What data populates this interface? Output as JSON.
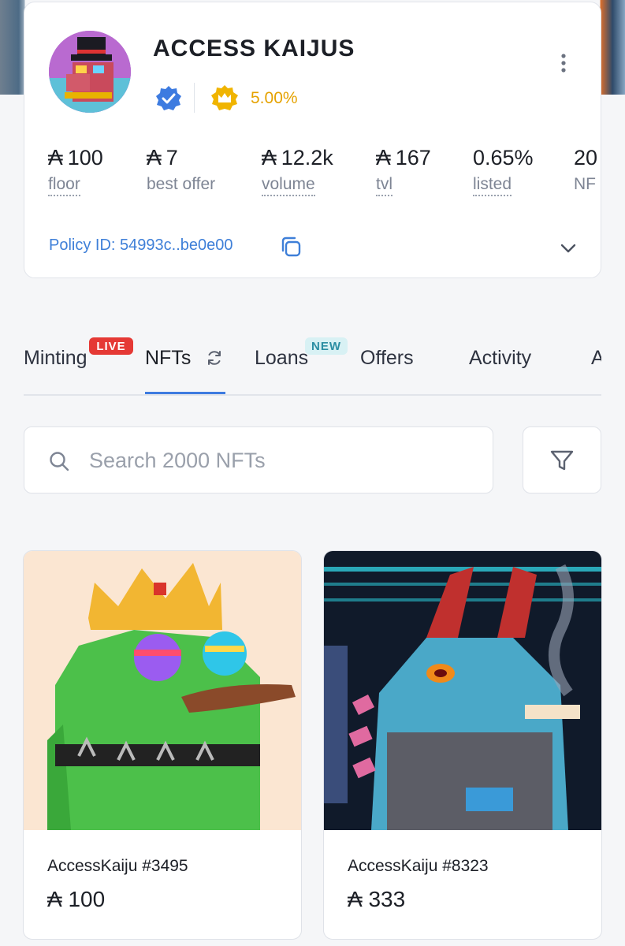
{
  "collection": {
    "name": "ACCESS KAIJUS",
    "royalty": "5.00%",
    "policy_id": "Policy ID: 54993c..be0e00"
  },
  "currency_symbol": "₳",
  "stats": [
    {
      "value": "100",
      "label": "floor",
      "ada": true
    },
    {
      "value": "7",
      "label": "best offer",
      "ada": true
    },
    {
      "value": "12.2k",
      "label": "volume",
      "ada": true
    },
    {
      "value": "167",
      "label": "tvl",
      "ada": true
    },
    {
      "value": "0.65%",
      "label": "listed",
      "ada": false
    },
    {
      "value": "20",
      "label": "NF",
      "ada": false
    }
  ],
  "tabs": [
    {
      "label": "Minting",
      "badge": "LIVE"
    },
    {
      "label": "NFTs"
    },
    {
      "label": "Loans",
      "badge": "NEW"
    },
    {
      "label": "Offers"
    },
    {
      "label": "Activity"
    },
    {
      "label": "A"
    }
  ],
  "search": {
    "placeholder": "Search 2000 NFTs"
  },
  "nfts": [
    {
      "name": "AccessKaiju #3495",
      "price": "100"
    },
    {
      "name": "AccessKaiju #8323",
      "price": "333"
    }
  ],
  "colors": {
    "accent": "#3d7be0",
    "royalty": "#e5a200",
    "live_badge": "#e53935",
    "new_badge_bg": "#d8f1f4"
  },
  "icons": [
    "verified-icon",
    "crown-icon",
    "more-vertical-icon",
    "copy-icon",
    "chevron-down-icon",
    "refresh-icon",
    "search-icon",
    "filter-icon"
  ]
}
